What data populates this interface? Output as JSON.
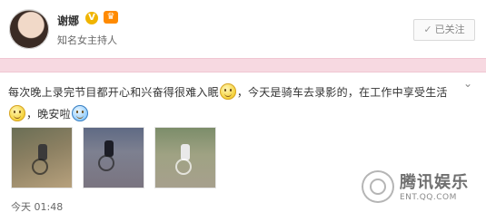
{
  "header": {
    "user_name": "谢娜",
    "verified_icon": "verified-v-icon",
    "member_icon": "member-crown-icon",
    "user_description": "知名女主持人",
    "follow_label": "已关注",
    "follow_icon": "check-icon"
  },
  "post": {
    "text_part1": "每次晚上录完节目都开心和兴奋得很难入眠",
    "text_part2": "，今天是骑车去录影的，在工作中享受生活",
    "text_part3": "，晚安啦",
    "emoji_1": "emoji-sleepy",
    "emoji_2": "emoji-smile",
    "emoji_3": "emoji-moon-goodnight",
    "images": [
      {
        "alt": "riding bicycle on dirt road"
      },
      {
        "alt": "riding bicycle on paved road"
      },
      {
        "alt": "riding bicycle on tree-lined road"
      }
    ],
    "timestamp": "今天 01:48"
  },
  "watermark": {
    "brand": "腾讯娱乐",
    "domain": "ENT.QQ.COM"
  },
  "colors": {
    "pink_band": "#f7d9e1",
    "verified": "#f0b400",
    "member": "#ff8a00"
  }
}
